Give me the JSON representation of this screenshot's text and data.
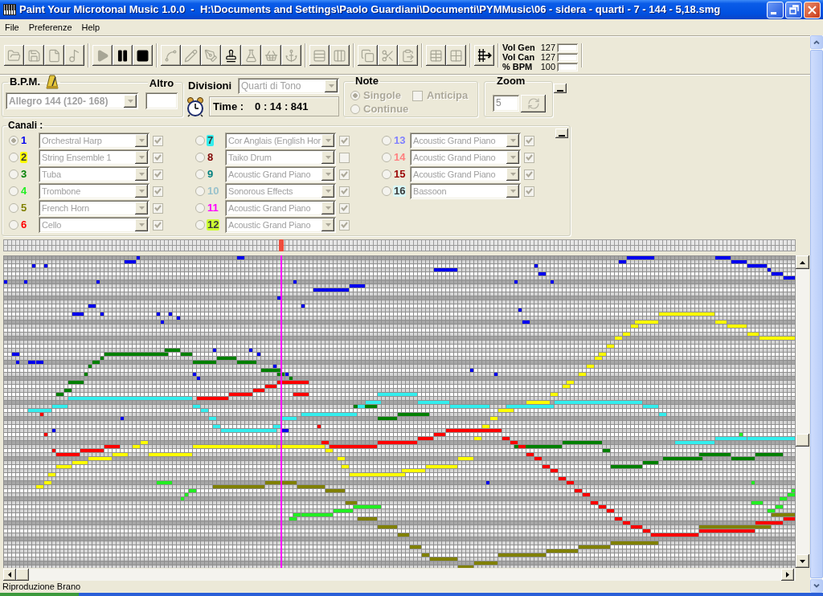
{
  "window": {
    "title": "Paint Your Microtonal Music 1.0.0  -  H:\\Documents and Settings\\Paolo Guardiani\\Documenti\\PYMMusic\\06 - sidera - quarti - 7 - 144 - 5,18.smg"
  },
  "menu": [
    "File",
    "Preferenze",
    "Help"
  ],
  "toolbar": {
    "groups": [
      [
        {
          "kind": "open",
          "disabled": true
        },
        {
          "kind": "save",
          "disabled": true
        },
        {
          "kind": "new",
          "disabled": true
        },
        {
          "kind": "music",
          "disabled": true
        }
      ],
      [
        {
          "kind": "play",
          "disabled": true
        },
        {
          "kind": "pause",
          "disabled": false
        },
        {
          "kind": "stop",
          "disabled": false
        }
      ],
      [
        {
          "kind": "curve",
          "disabled": true
        },
        {
          "kind": "pencil",
          "disabled": true
        },
        {
          "kind": "pen",
          "disabled": true
        },
        {
          "kind": "stamp",
          "disabled": false
        },
        {
          "kind": "flask",
          "disabled": true
        },
        {
          "kind": "basket",
          "disabled": true
        },
        {
          "kind": "anchor",
          "disabled": true
        }
      ],
      [
        {
          "kind": "rows",
          "disabled": true
        },
        {
          "kind": "columns",
          "disabled": true
        }
      ],
      [
        {
          "kind": "copy",
          "disabled": true
        },
        {
          "kind": "cut",
          "disabled": true
        },
        {
          "kind": "paste",
          "disabled": true
        }
      ],
      [
        {
          "kind": "table",
          "disabled": true
        },
        {
          "kind": "grid",
          "disabled": true
        }
      ],
      [
        {
          "kind": "extend",
          "disabled": false
        }
      ]
    ],
    "volumes": [
      {
        "label": "Vol Gen",
        "value": "127"
      },
      {
        "label": "Vol Can",
        "value": "127"
      },
      {
        "label": "% BPM",
        "value": "100"
      }
    ]
  },
  "tempo": {
    "label": "B.P.M.",
    "preset": "Allegro 144 (120- 168)",
    "disabled": true,
    "other_label": "Altro"
  },
  "divisions": {
    "label": "Divisioni",
    "value": "Quarti di Tono",
    "disabled": true,
    "time_label": "Time :",
    "time": "0 : 14 : 841"
  },
  "note_mode": {
    "label": "Note",
    "disabled": true,
    "options": [
      {
        "label": "Singole",
        "selected": true
      },
      {
        "label": "Continue",
        "selected": false
      }
    ],
    "anticipate": {
      "label": "Anticipa",
      "checked": false
    }
  },
  "zoom": {
    "label": "Zoom",
    "value": "5",
    "disabled": true
  },
  "channels": {
    "label": "Canali :",
    "disabled": true,
    "items": [
      {
        "number": "1",
        "color": "#0000ee",
        "instrument": "Orchestral Harp",
        "selected": true,
        "checked": true
      },
      {
        "number": "2",
        "color": "#ffff00",
        "instrument": "String Ensemble 1",
        "selected": false,
        "checked": true
      },
      {
        "number": "3",
        "color": "#008000",
        "instrument": "Tuba",
        "selected": false,
        "checked": true
      },
      {
        "number": "4",
        "color": "#22ee22",
        "instrument": "Trombone",
        "selected": false,
        "checked": true
      },
      {
        "number": "5",
        "color": "#808000",
        "instrument": "French Horn",
        "selected": false,
        "checked": true
      },
      {
        "number": "6",
        "color": "#ff0000",
        "instrument": "Cello",
        "selected": false,
        "checked": true
      },
      {
        "number": "7",
        "color": "#33eeee",
        "instrument": "Cor Anglais (English Hor",
        "selected": false,
        "checked": true
      },
      {
        "number": "8",
        "color": "#800000",
        "instrument": "Taiko Drum",
        "selected": false,
        "checked": false
      },
      {
        "number": "9",
        "color": "#008080",
        "instrument": "Acoustic Grand Piano",
        "selected": false,
        "checked": true
      },
      {
        "number": "10",
        "color": "#99c2cc",
        "instrument": "Sonorous Effects",
        "selected": false,
        "checked": true
      },
      {
        "number": "11",
        "color": "#ff00ff",
        "instrument": "Acoustic Grand Piano",
        "selected": false,
        "checked": true
      },
      {
        "number": "12",
        "color": "#ccff33",
        "instrument": "Acoustic Grand Piano",
        "selected": false,
        "checked": true
      },
      {
        "number": "13",
        "color": "#8080ff",
        "instrument": "Acoustic Grand Piano",
        "selected": false,
        "checked": true
      },
      {
        "number": "14",
        "color": "#ff8080",
        "instrument": "Acoustic Grand Piano",
        "selected": false,
        "checked": true
      },
      {
        "number": "15",
        "color": "#990000",
        "instrument": "Acoustic Grand Piano",
        "selected": false,
        "checked": true
      },
      {
        "number": "16",
        "color": "#d8f8f8",
        "instrument": "Bassoon",
        "selected": false,
        "checked": true
      }
    ]
  },
  "status_bar": "Riproduzione Brano"
}
